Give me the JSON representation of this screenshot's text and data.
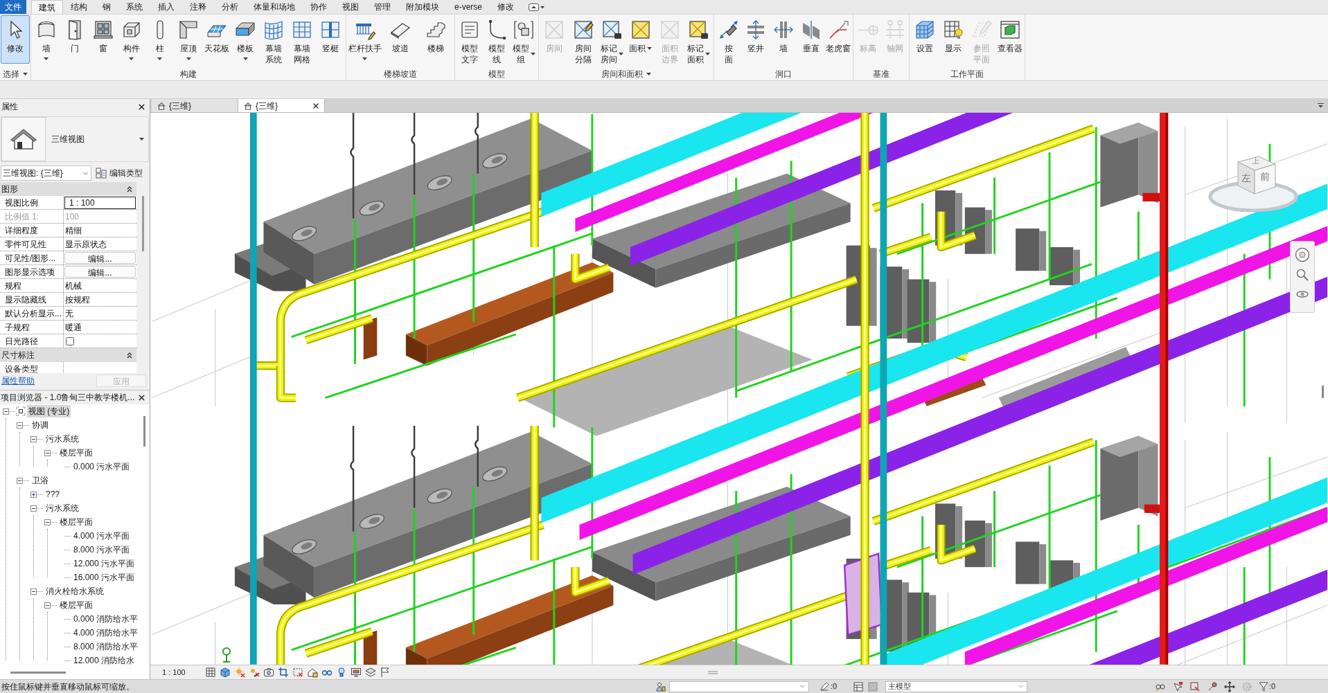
{
  "menu_tabs": [
    {
      "label": "文件",
      "kind": "file",
      "selected": false
    },
    {
      "label": "建筑",
      "kind": "tab",
      "selected": true
    },
    {
      "label": "结构",
      "kind": "tab",
      "selected": false
    },
    {
      "label": "钢",
      "kind": "tab",
      "selected": false
    },
    {
      "label": "系统",
      "kind": "tab",
      "selected": false
    },
    {
      "label": "插入",
      "kind": "tab",
      "selected": false
    },
    {
      "label": "注释",
      "kind": "tab",
      "selected": false
    },
    {
      "label": "分析",
      "kind": "tab",
      "selected": false
    },
    {
      "label": "体量和场地",
      "kind": "tab",
      "selected": false
    },
    {
      "label": "协作",
      "kind": "tab",
      "selected": false
    },
    {
      "label": "视图",
      "kind": "tab",
      "selected": false
    },
    {
      "label": "管理",
      "kind": "tab",
      "selected": false
    },
    {
      "label": "附加模块",
      "kind": "tab",
      "selected": false
    },
    {
      "label": "e-verse",
      "kind": "tab",
      "selected": false
    },
    {
      "label": "修改",
      "kind": "tab",
      "selected": false
    }
  ],
  "ribbon_panels": [
    {
      "title": "选择",
      "has_menu": true,
      "tools": [
        {
          "label": "修改",
          "kind": "single",
          "dropdown": false,
          "selected": true,
          "disabled": false
        }
      ]
    },
    {
      "title": "构建",
      "has_menu": false,
      "tools": [
        {
          "label": "墙",
          "kind": "single",
          "dropdown": true,
          "selected": false,
          "disabled": false
        },
        {
          "label": "门",
          "kind": "single",
          "dropdown": false,
          "selected": false,
          "disabled": false
        },
        {
          "label": "窗",
          "kind": "single",
          "dropdown": false,
          "selected": false,
          "disabled": false
        },
        {
          "label": "构件",
          "kind": "single",
          "dropdown": true,
          "selected": false,
          "disabled": false
        },
        {
          "label": "柱",
          "kind": "single",
          "dropdown": true,
          "selected": false,
          "disabled": false
        },
        {
          "label": "屋顶",
          "kind": "single",
          "dropdown": true,
          "selected": false,
          "disabled": false
        },
        {
          "label": "天花板",
          "kind": "single",
          "dropdown": false,
          "selected": false,
          "disabled": false
        },
        {
          "label": "楼板",
          "kind": "single",
          "dropdown": true,
          "selected": false,
          "disabled": false
        },
        {
          "label": "幕墙系统",
          "kind": "stacked",
          "dropdown": false,
          "selected": false,
          "disabled": false
        },
        {
          "label": "幕墙网格",
          "kind": "stacked",
          "dropdown": false,
          "selected": false,
          "disabled": false
        },
        {
          "label": "竖梃",
          "kind": "single",
          "dropdown": false,
          "selected": false,
          "disabled": false
        }
      ]
    },
    {
      "title": "楼梯坡道",
      "has_menu": false,
      "tools": [
        {
          "label": "栏杆扶手",
          "kind": "single",
          "dropdown": true,
          "selected": false,
          "disabled": false
        },
        {
          "label": "坡道",
          "kind": "single",
          "dropdown": false,
          "selected": false,
          "disabled": false
        },
        {
          "label": "楼梯",
          "kind": "single",
          "dropdown": false,
          "selected": false,
          "disabled": false
        }
      ]
    },
    {
      "title": "模型",
      "has_menu": false,
      "tools": [
        {
          "label": "模型文字",
          "kind": "stacked",
          "dropdown": false,
          "selected": false,
          "disabled": false
        },
        {
          "label": "模型线",
          "kind": "stacked",
          "dropdown": false,
          "selected": false,
          "disabled": false
        },
        {
          "label": "模型组",
          "kind": "stacked",
          "dropdown": true,
          "selected": false,
          "disabled": false
        }
      ]
    },
    {
      "title": "房间和面积",
      "has_menu": true,
      "tools": [
        {
          "label": "房间",
          "kind": "single",
          "dropdown": false,
          "selected": false,
          "disabled": true
        },
        {
          "label": "房间分隔",
          "kind": "stacked",
          "dropdown": false,
          "selected": false,
          "disabled": false
        },
        {
          "label": "标记房间",
          "kind": "stacked",
          "dropdown": true,
          "selected": false,
          "disabled": false
        },
        {
          "label": "面积",
          "kind": "inline",
          "dropdown": true,
          "selected": false,
          "disabled": false
        },
        {
          "label": "面积边界",
          "kind": "stacked",
          "dropdown": false,
          "selected": false,
          "disabled": true
        },
        {
          "label": "标记面积",
          "kind": "stacked",
          "dropdown": true,
          "selected": false,
          "disabled": false
        }
      ]
    },
    {
      "title": "洞口",
      "has_menu": false,
      "tools": [
        {
          "label": "按面",
          "kind": "column",
          "dropdown": false,
          "selected": false,
          "disabled": false
        },
        {
          "label": "竖井",
          "kind": "single",
          "dropdown": false,
          "selected": false,
          "disabled": false
        },
        {
          "label": "墙",
          "kind": "single",
          "dropdown": false,
          "selected": false,
          "disabled": false
        },
        {
          "label": "垂直",
          "kind": "single",
          "dropdown": false,
          "selected": false,
          "disabled": false
        },
        {
          "label": "老虎窗",
          "kind": "single",
          "dropdown": false,
          "selected": false,
          "disabled": false
        }
      ]
    },
    {
      "title": "基准",
      "has_menu": false,
      "tools": [
        {
          "label": "标高",
          "kind": "single",
          "dropdown": false,
          "selected": false,
          "disabled": true
        },
        {
          "label": "轴网",
          "kind": "single",
          "dropdown": false,
          "selected": false,
          "disabled": true
        }
      ]
    },
    {
      "title": "工作平面",
      "has_menu": false,
      "tools": [
        {
          "label": "设置",
          "kind": "single",
          "dropdown": false,
          "selected": false,
          "disabled": false
        },
        {
          "label": "显示",
          "kind": "single",
          "dropdown": false,
          "selected": false,
          "disabled": false
        },
        {
          "label": "参照平面",
          "kind": "stacked",
          "dropdown": false,
          "selected": false,
          "disabled": true
        },
        {
          "label": "查看器",
          "kind": "single",
          "dropdown": false,
          "selected": false,
          "disabled": false
        }
      ]
    }
  ],
  "properties": {
    "title": "属性",
    "type_name": "三维视图",
    "instance": "三维视图: {三维}",
    "edit_type": "编辑类型",
    "groups": [
      {
        "title": "图形",
        "expanded": true,
        "rows": [
          {
            "kind": "input",
            "label": "视图比例",
            "value": "1 : 100",
            "disabled": false
          },
          {
            "kind": "text",
            "label": "比例值 1:",
            "value": "100",
            "disabled": true
          },
          {
            "kind": "text",
            "label": "详细程度",
            "value": "精细",
            "disabled": false
          },
          {
            "kind": "text",
            "label": "零件可见性",
            "value": "显示原状态",
            "disabled": false
          },
          {
            "kind": "button",
            "label": "可见性/图形...",
            "value": "编辑...",
            "disabled": false
          },
          {
            "kind": "button",
            "label": "图形显示选项",
            "value": "编辑...",
            "disabled": false
          },
          {
            "kind": "text",
            "label": "规程",
            "value": "机械",
            "disabled": false
          },
          {
            "kind": "text",
            "label": "显示隐藏线",
            "value": "按规程",
            "disabled": false
          },
          {
            "kind": "text",
            "label": "默认分析显示...",
            "value": "无",
            "disabled": false
          },
          {
            "kind": "text",
            "label": "子规程",
            "value": "暖通",
            "disabled": false
          },
          {
            "kind": "checkbox",
            "label": "日光路径",
            "checked": false,
            "disabled": false
          }
        ]
      },
      {
        "title": "尺寸标注",
        "expanded": true,
        "rows": [
          {
            "kind": "text",
            "label": "设备类型",
            "disabled": false
          }
        ]
      }
    ],
    "help": "属性帮助",
    "apply": {
      "label": "应用",
      "disabled": true
    }
  },
  "project_browser": {
    "title": "项目浏览器 - 1.0鲁甸三中教学楼机...",
    "tree": [
      {
        "label": "视图 (专业)",
        "expanded": true,
        "selected": true,
        "children": [
          {
            "label": "协调",
            "expanded": true,
            "selected": false,
            "children": [
              {
                "label": "污水系统",
                "expanded": true,
                "selected": false,
                "children": [
                  {
                    "label": "楼层平面",
                    "expanded": true,
                    "selected": false,
                    "children": [
                      {
                        "label": "0.000 污水平面",
                        "selected": false
                      }
                    ]
                  }
                ]
              }
            ]
          },
          {
            "label": "卫浴",
            "expanded": true,
            "selected": false,
            "children": [
              {
                "label": "???",
                "expanded": false,
                "selected": false
              },
              {
                "label": "污水系统",
                "expanded": true,
                "selected": false,
                "children": [
                  {
                    "label": "楼层平面",
                    "expanded": true,
                    "selected": false,
                    "children": [
                      {
                        "label": "4.000 污水平面",
                        "selected": false
                      },
                      {
                        "label": "8.000 污水平面",
                        "selected": false
                      },
                      {
                        "label": "12.000 污水平面",
                        "selected": false
                      },
                      {
                        "label": "16.000 污水平面",
                        "selected": false
                      }
                    ]
                  }
                ]
              },
              {
                "label": "消火栓给水系统",
                "expanded": true,
                "selected": false,
                "children": [
                  {
                    "label": "楼层平面",
                    "expanded": true,
                    "selected": false,
                    "children": [
                      {
                        "label": "0.000 消防给水平",
                        "selected": false
                      },
                      {
                        "label": "4.000 消防给水平",
                        "selected": false
                      },
                      {
                        "label": "8.000 消防给水平",
                        "selected": false
                      },
                      {
                        "label": "12.000 消防给水",
                        "selected": false
                      }
                    ]
                  }
                ]
              }
            ]
          }
        ]
      }
    ]
  },
  "view_tabs": [
    {
      "label": "{三维}",
      "selected": false,
      "closable": false
    },
    {
      "label": "{三维}",
      "selected": true,
      "closable": true
    }
  ],
  "viewport": {
    "viewcube": {
      "top": "上",
      "left": "左",
      "front": "前"
    },
    "scale": "1 : 100"
  },
  "status_bar": {
    "message": "按住鼠标键并垂直移动鼠标可缩放。",
    "editable_count": ":0",
    "active_model": "主模型",
    "filter_count": ":0"
  }
}
